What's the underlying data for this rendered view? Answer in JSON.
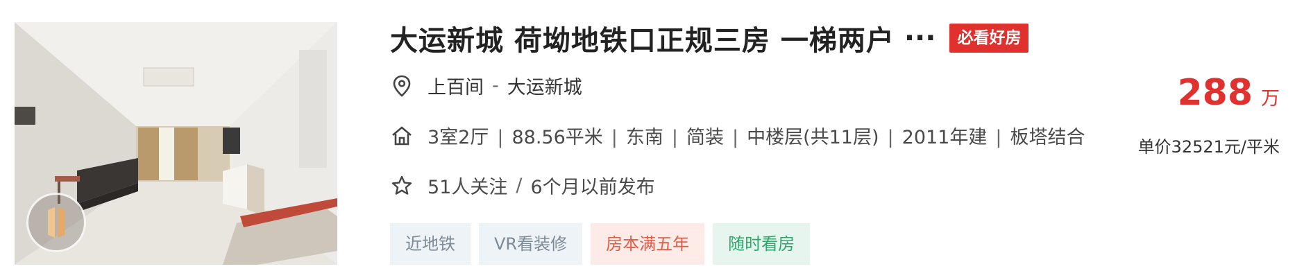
{
  "listing": {
    "title": "大运新城 荷坳地铁口正规三房 一梯两户",
    "title_ellipsis": "···",
    "must_see_tag": "必看好房",
    "location": {
      "area": "上百间",
      "separator": "-",
      "community": "大运新城"
    },
    "attributes": [
      "3室2厅",
      "88.56平米",
      "东南",
      "简装",
      "中楼层(共11层)",
      "2011年建",
      "板塔结合"
    ],
    "follow_info": "51人关注",
    "publish_info": "6个月以前发布",
    "tags": [
      {
        "label": "近地铁",
        "style": "grey"
      },
      {
        "label": "VR看装修",
        "style": "grey"
      },
      {
        "label": "房本满五年",
        "style": "red"
      },
      {
        "label": "随时看房",
        "style": "green"
      }
    ],
    "price": {
      "value": "288",
      "unit": "万",
      "unit_price": "单价32521元/平米"
    },
    "icons": {
      "location": "location-pin-icon",
      "attributes": "house-icon",
      "follow": "star-icon",
      "vr": "vr-play-icon"
    },
    "colors": {
      "accent_red": "#e0312f",
      "tag_grey_bg": "#eef3f7",
      "tag_red_bg": "#fdebe8",
      "tag_green_bg": "#e6f6ee"
    }
  }
}
